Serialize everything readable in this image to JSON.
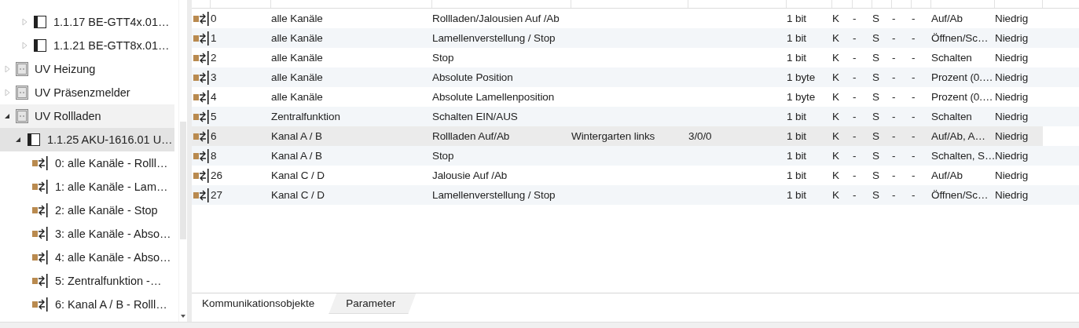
{
  "tree": {
    "items": [
      {
        "kind": "device",
        "label": "1.1.17 BE-GTT4x.01…",
        "expanded": false,
        "selected": false,
        "hovered": false
      },
      {
        "kind": "device",
        "label": "1.1.21 BE-GTT8x.01…",
        "expanded": false,
        "selected": false,
        "hovered": false
      },
      {
        "kind": "group",
        "label": "UV Heizung",
        "expanded": false,
        "selected": false,
        "hovered": false
      },
      {
        "kind": "group",
        "label": "UV Präsenzmelder",
        "expanded": false,
        "selected": false,
        "hovered": false
      },
      {
        "kind": "group",
        "label": "UV Rollladen",
        "expanded": true,
        "selected": false,
        "hovered": true,
        "children": [
          {
            "kind": "device",
            "label": "1.1.25 AKU-1616.01 U…",
            "expanded": true,
            "selected": true,
            "hovered": false,
            "children": [
              {
                "kind": "object",
                "label": "0: alle Kanäle - Rolll…",
                "selected": false,
                "hovered": false
              },
              {
                "kind": "object",
                "label": "1: alle Kanäle - Lam…",
                "selected": false,
                "hovered": false
              },
              {
                "kind": "object",
                "label": "2: alle Kanäle - Stop",
                "selected": false,
                "hovered": false
              },
              {
                "kind": "object",
                "label": "3: alle Kanäle - Abso…",
                "selected": false,
                "hovered": false
              },
              {
                "kind": "object",
                "label": "4: alle Kanäle - Abso…",
                "selected": false,
                "hovered": false
              },
              {
                "kind": "object",
                "label": "5: Zentralfunktion -…",
                "selected": false,
                "hovered": false
              },
              {
                "kind": "object",
                "label": "6: Kanal A / B - Rolll…",
                "selected": false,
                "hovered": false
              }
            ]
          }
        ]
      }
    ]
  },
  "table": {
    "rows": [
      {
        "number": "0",
        "name": "alle Kanäle",
        "function": "Rollladen/Jalousien Auf /Ab",
        "length": "1 bit",
        "flags": [
          "K",
          "-",
          "S",
          "-",
          "-"
        ],
        "datatype": "Auf/Ab",
        "priority": "Niedrig",
        "selected": false
      },
      {
        "number": "1",
        "name": "alle Kanäle",
        "function": "Lamellenverstellung / Stop",
        "length": "1 bit",
        "flags": [
          "K",
          "-",
          "S",
          "-",
          "-"
        ],
        "datatype": "Öffnen/Sc…",
        "priority": "Niedrig",
        "selected": false
      },
      {
        "number": "2",
        "name": "alle Kanäle",
        "function": "Stop",
        "length": "1 bit",
        "flags": [
          "K",
          "-",
          "S",
          "-",
          "-"
        ],
        "datatype": "Schalten",
        "priority": "Niedrig",
        "selected": false
      },
      {
        "number": "3",
        "name": "alle Kanäle",
        "function": "Absolute Position",
        "length": "1 byte",
        "flags": [
          "K",
          "-",
          "S",
          "-",
          "-"
        ],
        "datatype": "Prozent (0.…",
        "priority": "Niedrig",
        "selected": false
      },
      {
        "number": "4",
        "name": "alle Kanäle",
        "function": "Absolute Lamellenposition",
        "length": "1 byte",
        "flags": [
          "K",
          "-",
          "S",
          "-",
          "-"
        ],
        "datatype": "Prozent (0.…",
        "priority": "Niedrig",
        "selected": false
      },
      {
        "number": "5",
        "name": "Zentralfunktion",
        "function": "Schalten EIN/AUS",
        "length": "1 bit",
        "flags": [
          "K",
          "-",
          "S",
          "-",
          "-"
        ],
        "datatype": "Schalten",
        "priority": "Niedrig",
        "selected": false
      },
      {
        "number": "6",
        "name": "Kanal A / B",
        "function": "Rollladen Auf/Ab",
        "description": "Wintergarten links",
        "group_address": "3/0/0",
        "length": "1 bit",
        "flags": [
          "K",
          "-",
          "S",
          "-",
          "-"
        ],
        "datatype": "Auf/Ab, A…",
        "priority": "Niedrig",
        "selected": true
      },
      {
        "number": "8",
        "name": "Kanal A / B",
        "function": "Stop",
        "length": "1 bit",
        "flags": [
          "K",
          "-",
          "S",
          "-",
          "-"
        ],
        "datatype": "Schalten, S…",
        "priority": "Niedrig",
        "selected": false
      },
      {
        "number": "26",
        "name": "Kanal C / D",
        "function": "Jalousie Auf /Ab",
        "length": "1 bit",
        "flags": [
          "K",
          "-",
          "S",
          "-",
          "-"
        ],
        "datatype": "Auf/Ab",
        "priority": "Niedrig",
        "selected": false
      },
      {
        "number": "27",
        "name": "Kanal C / D",
        "function": "Lamellenverstellung / Stop",
        "length": "1 bit",
        "flags": [
          "K",
          "-",
          "S",
          "-",
          "-"
        ],
        "datatype": "Öffnen/Sc…",
        "priority": "Niedrig",
        "selected": false
      }
    ]
  },
  "tabs": [
    {
      "label": "Kommunikationsobjekte",
      "selected": true
    },
    {
      "label": "Parameter",
      "selected": false
    }
  ]
}
